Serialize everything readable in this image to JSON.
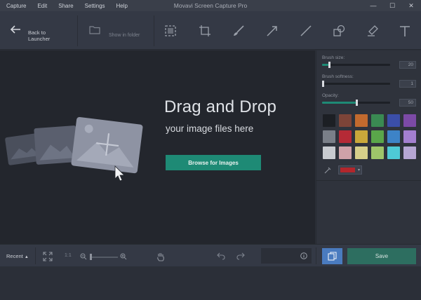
{
  "window": {
    "title": "Movavi Screen Capture Pro",
    "menu": [
      "Capture",
      "Edit",
      "Share",
      "Settings",
      "Help"
    ],
    "controls": {
      "minimize": "—",
      "maximize": "☐",
      "close": "✕"
    }
  },
  "toolbar": {
    "back_line1": "Back to",
    "back_line2": "Launcher",
    "show_in_folder": "Show in folder",
    "tools": [
      "select-area-icon",
      "crop-icon",
      "brush-icon",
      "arrow-icon",
      "line-icon",
      "shapes-icon",
      "highlighter-icon",
      "text-icon"
    ]
  },
  "canvas": {
    "title": "Drag and Drop",
    "subtitle": "your image files here",
    "browse_label": "Browse for Images"
  },
  "panel": {
    "brush_size": {
      "label": "Brush size:",
      "value": "20",
      "level": 0.1
    },
    "brush_softness": {
      "label": "Brush softness:",
      "value": "1",
      "level": 0.01
    },
    "opacity": {
      "label": "Opacity:",
      "value": "50",
      "level": 0.5
    },
    "palette": [
      [
        "#1c1f24",
        "#7c4438",
        "#c26a2e",
        "#3a8a52",
        "#3b4ea8",
        "#7c4aa6"
      ],
      [
        "#7a7f88",
        "#b52a36",
        "#c9a83a",
        "#5aa64a",
        "#3d83c7",
        "#a37fd0"
      ],
      [
        "#c8cbd0",
        "#cfa2a8",
        "#d6cf8a",
        "#9ec56a",
        "#4ec9d6",
        "#b6a6d4"
      ]
    ],
    "current_color": "#b3262c"
  },
  "bottombar": {
    "recent_label": "Recent",
    "one_to_one": "1:1",
    "save_label": "Save"
  },
  "colors": {
    "accent": "#1e8a75",
    "copy_button": "#4a7bbf",
    "save_button": "#2d6e60"
  }
}
